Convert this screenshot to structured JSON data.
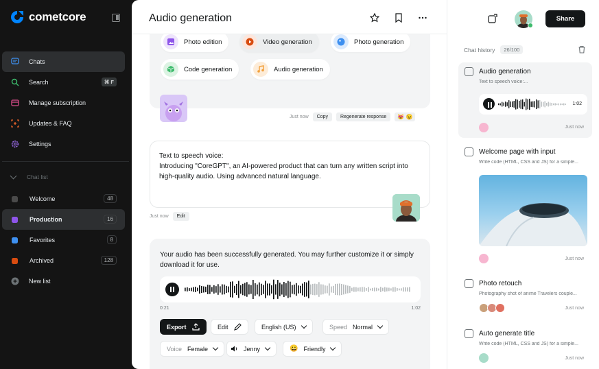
{
  "app": {
    "name": "cometcore"
  },
  "sidebar": {
    "nav": [
      {
        "label": "Chats",
        "icon": "chat-icon"
      },
      {
        "label": "Search",
        "icon": "search-icon",
        "shortcut": "⌘ F"
      },
      {
        "label": "Manage subscription",
        "icon": "card-icon"
      },
      {
        "label": "Updates & FAQ",
        "icon": "updates-icon"
      },
      {
        "label": "Settings",
        "icon": "gear-icon"
      }
    ],
    "chat_list_heading": "Chat list",
    "lists": [
      {
        "label": "Welcome",
        "count": "48",
        "color": "#4a4a4a"
      },
      {
        "label": "Production",
        "count": "16",
        "color": "#8e55ea"
      },
      {
        "label": "Favorites",
        "count": "8",
        "color": "#3e90f0"
      },
      {
        "label": "Archived",
        "count": "128",
        "color": "#d84c10"
      }
    ],
    "new_list": "New list"
  },
  "main": {
    "title": "Audio generation",
    "pills": [
      "Photo edition",
      "Video generation",
      "Photo generation",
      "Code generation",
      "Audio generation"
    ],
    "meta1": {
      "time": "Just now",
      "copy": "Copy",
      "regen": "Regenerate response"
    },
    "user_message": {
      "line1": "Text to speech voice:",
      "body": "Introducing \"CoreGPT\", an AI-powered product that can turn any written script into high-quality audio. Using advanced natural language."
    },
    "meta2": {
      "time": "Just now",
      "edit": "Edit"
    },
    "gen": {
      "text": "Your audio has been successfully generated. You may further customize it or simply download it for use.",
      "time_start": "0:21",
      "time_end": "1:02",
      "export": "Export",
      "edit": "Edit",
      "language": "English (US)",
      "speed_label": "Speed",
      "speed": "Normal",
      "voice_label": "Voice",
      "voice": "Female",
      "name": "Jenny",
      "tone": "Friendly"
    }
  },
  "right": {
    "share": "Share",
    "history_label": "Chat history",
    "history_count": "26/100",
    "items": [
      {
        "title": "Audio generation",
        "sub": "Text to speech voice:...",
        "duration": "1:02",
        "time": "Just now"
      },
      {
        "title": "Welcome page with input",
        "sub": "Write code (HTML, CSS and JS) for a simple...",
        "time": "Just now"
      },
      {
        "title": "Photo retouch",
        "sub": "Photography shot of anime Travelers couple...",
        "time": "Just now"
      },
      {
        "title": "Auto generate title",
        "sub": "Write code (HTML, CSS and JS) for a simple...",
        "time": "Just now"
      }
    ]
  },
  "colors": {
    "accent": "#0084ff",
    "dark": "#141718",
    "sidebar": "#141414"
  }
}
